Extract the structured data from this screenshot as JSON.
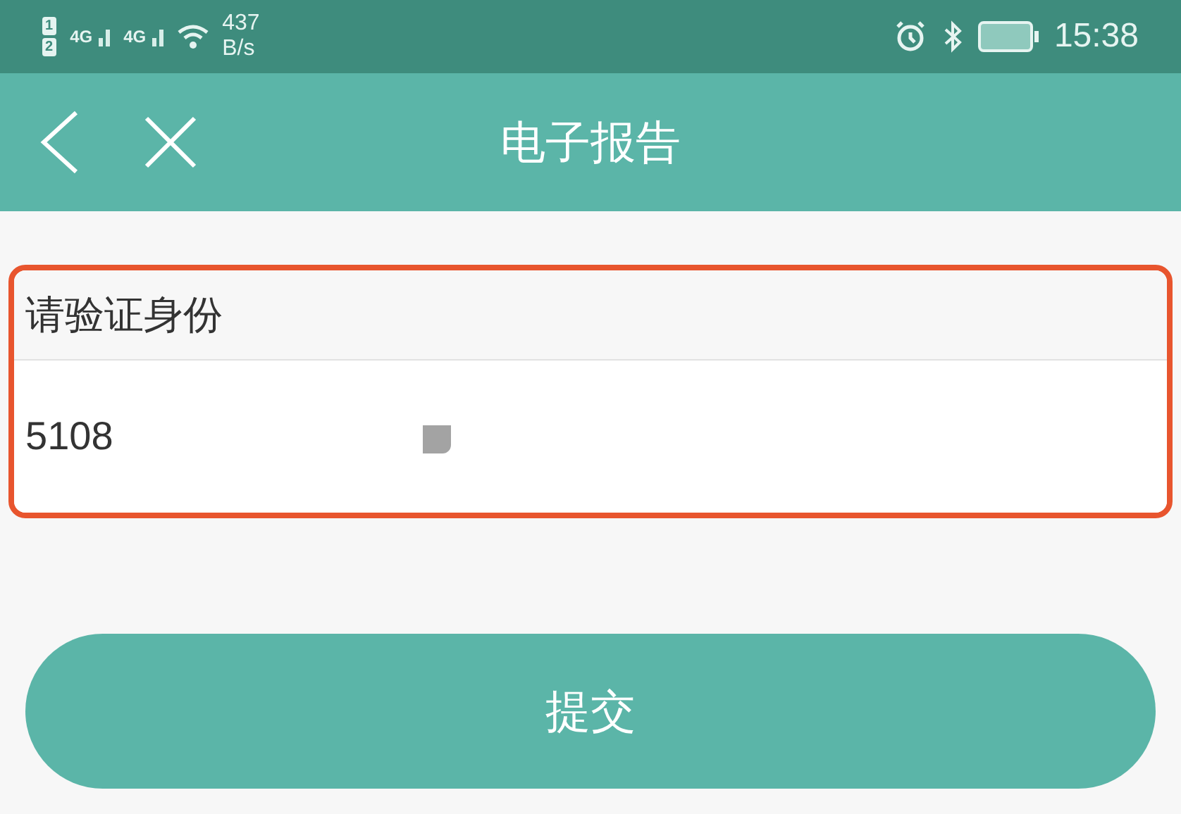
{
  "status_bar": {
    "sim_slots": [
      "1",
      "2"
    ],
    "networks": [
      "4G",
      "4G"
    ],
    "speed_value": "437",
    "speed_unit": "B/s",
    "time": "15:38"
  },
  "header": {
    "title": "电子报告"
  },
  "form": {
    "label": "请验证身份",
    "value": "5108",
    "highlighted": true
  },
  "submit_button": {
    "label": "提交"
  }
}
